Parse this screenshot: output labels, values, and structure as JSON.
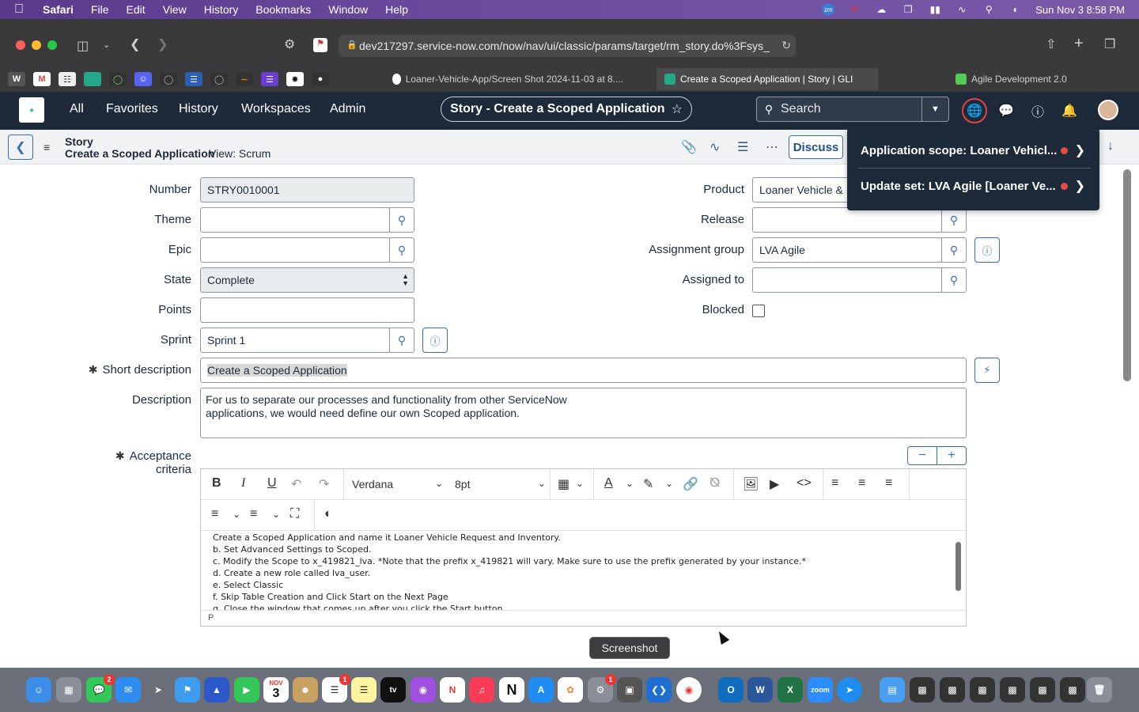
{
  "menubar": {
    "app": "Safari",
    "items": [
      "File",
      "Edit",
      "View",
      "History",
      "Bookmarks",
      "Window",
      "Help"
    ],
    "clock": "Sun Nov 3  8:58 PM"
  },
  "browser": {
    "url": "dev217297.service-now.com/now/nav/ui/classic/params/target/rm_story.do%3Fsys_",
    "tabs": [
      {
        "label": "Loaner-Vehicle-App/Screen Shot 2024-11-03 at 8...."
      },
      {
        "label": "Create a Scoped Application | Story | GLI"
      },
      {
        "label": "Agile Development 2.0"
      }
    ]
  },
  "snheader": {
    "nav": [
      "All",
      "Favorites",
      "History",
      "Workspaces",
      "Admin"
    ],
    "context_title": "Story - Create a Scoped Application",
    "search_placeholder": "Search"
  },
  "formbar": {
    "record_type": "Story",
    "record_name": "Create a Scoped Application",
    "view": "View: Scrum",
    "discuss_label": "Discuss"
  },
  "scope_popover": {
    "application_scope": "Application scope: Loaner Vehicl...",
    "update_set": "Update set: LVA Agile [Loaner Ve..."
  },
  "form": {
    "number_label": "Number",
    "number": "STRY0010001",
    "theme_label": "Theme",
    "theme": "",
    "epic_label": "Epic",
    "epic": "",
    "state_label": "State",
    "state": "Complete",
    "points_label": "Points",
    "points": "",
    "sprint_label": "Sprint",
    "sprint": "Sprint 1",
    "product_label": "Product",
    "product": "Loaner Vehicle & In",
    "release_label": "Release",
    "release": "",
    "assignment_group_label": "Assignment group",
    "assignment_group": "LVA Agile",
    "assigned_to_label": "Assigned to",
    "assigned_to": "",
    "blocked_label": "Blocked",
    "short_description_label": "Short description",
    "short_description": "Create a Scoped Application",
    "description_label": "Description",
    "description_line1": "For us to separate our processes and functionality from other ServiceNow",
    "description_line2": "applications, we would need define our own Scoped application.",
    "acceptance_label": "Acceptance criteria"
  },
  "editor": {
    "font": "Verdana",
    "size": "8pt",
    "lines": [
      "Create a Scoped Application and name it Loaner Vehicle Request and Inventory.",
      "b. Set Advanced Settings to Scoped.",
      "c. Modify the Scope to x_419821_lva. *Note that the prefix x_419821 will vary. Make sure to use the prefix generated by your instance.*",
      "d. Create a new role called lva_user.",
      "e. Select Classic",
      "f. Skip Table Creation and Click Start on the Next Page",
      "g. Close the window that comes up after you click the Start button."
    ],
    "status": "P"
  },
  "dock": {
    "tooltip": "Screenshot",
    "messages_badge": "2",
    "reminders_badge": "1",
    "settings_badge": "1",
    "calendar_month": "NOV",
    "calendar_day": "3"
  }
}
